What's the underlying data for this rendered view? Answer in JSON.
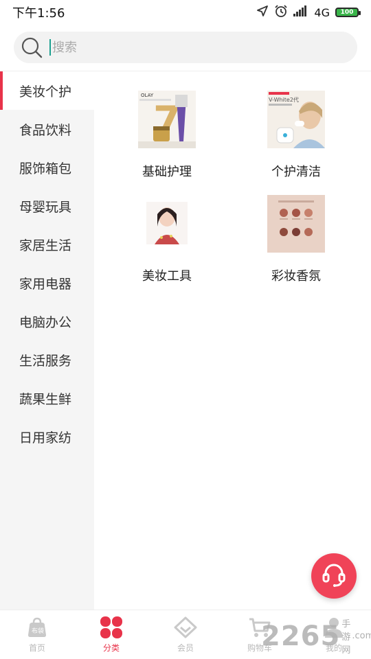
{
  "status": {
    "time": "下午1:56",
    "network": "4G",
    "battery": "100"
  },
  "search": {
    "placeholder": "搜索"
  },
  "sidebar": {
    "items": [
      {
        "label": "美妆个护",
        "active": true
      },
      {
        "label": "食品饮料",
        "active": false
      },
      {
        "label": "服饰箱包",
        "active": false
      },
      {
        "label": "母婴玩具",
        "active": false
      },
      {
        "label": "家居生活",
        "active": false
      },
      {
        "label": "家用电器",
        "active": false
      },
      {
        "label": "电脑办公",
        "active": false
      },
      {
        "label": "生活服务",
        "active": false
      },
      {
        "label": "蔬果生鲜",
        "active": false
      },
      {
        "label": "日用家纺",
        "active": false
      }
    ]
  },
  "categories": [
    {
      "label": "基础护理",
      "image_icon": "skincare-product-thumb",
      "brand_text": "OLAY"
    },
    {
      "label": "个护清洁",
      "image_icon": "toothbrush-product-thumb",
      "brand_text": "V-White2代"
    },
    {
      "label": "美妆工具",
      "image_icon": "model-portrait-thumb"
    },
    {
      "label": "彩妆香氛",
      "image_icon": "eyeshadow-palette-thumb"
    }
  ],
  "floating": {
    "icon": "headset-icon"
  },
  "bottom_nav": [
    {
      "label": "首页",
      "icon": "bag-icon",
      "active": false
    },
    {
      "label": "分类",
      "icon": "clover-icon",
      "active": true
    },
    {
      "label": "会员",
      "icon": "diamond-icon",
      "active": false
    },
    {
      "label": "购物车",
      "icon": "cart-icon",
      "active": false
    },
    {
      "label": "我的",
      "icon": "person-icon",
      "active": false
    }
  ],
  "watermark": {
    "number": "2265",
    "suffix": "手游网",
    "domain": ".com"
  },
  "colors": {
    "accent": "#e8334a",
    "sidebar_bg": "#f5f5f5",
    "search_bg": "#f2f2f2"
  }
}
